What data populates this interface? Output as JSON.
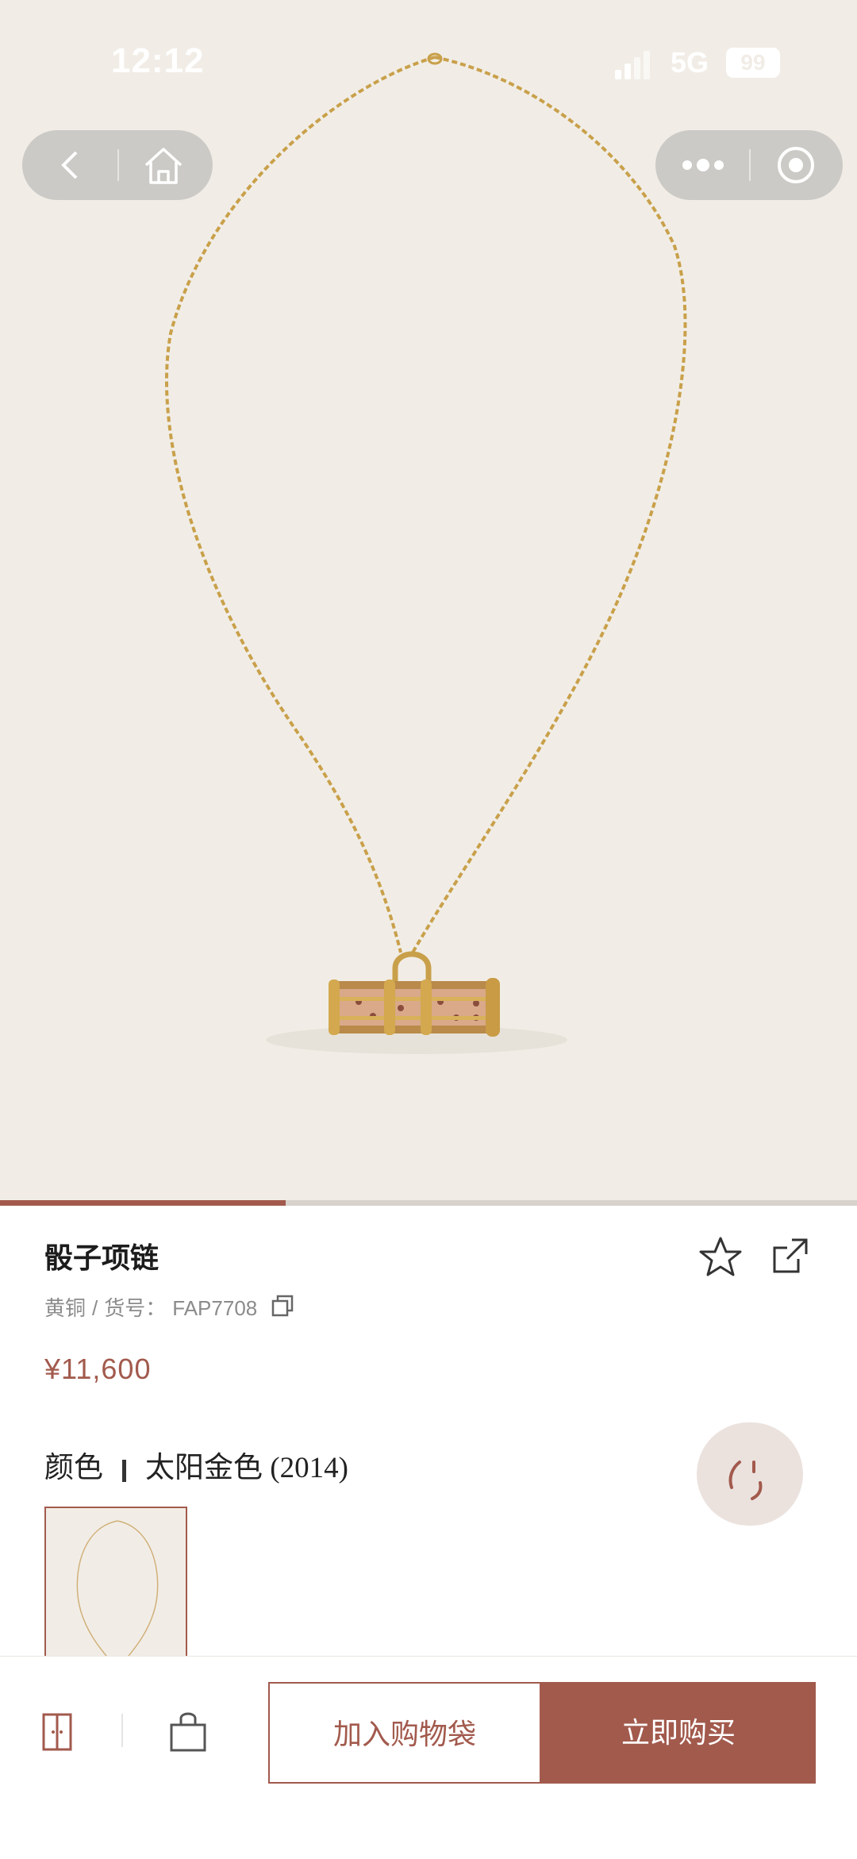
{
  "status_bar": {
    "time": "12:12",
    "network": "5G",
    "battery": "99"
  },
  "product": {
    "name": "骰子项链",
    "material": "黄铜",
    "sku_label": "货号：",
    "sku": "FAP7708",
    "price": "¥11,600",
    "color_label": "颜色",
    "color_value": "太阳金色 (2014)"
  },
  "gallery": {
    "progress": 0.333
  },
  "actions": {
    "add_to_bag": "加入购物袋",
    "buy_now": "立即购买"
  },
  "colors": {
    "accent": "#a25a4d",
    "background": "#f1ede6",
    "gold": "#c9a04a"
  },
  "icons": [
    "back-icon",
    "home-icon",
    "more-icon",
    "close-miniprogram-icon",
    "star-icon",
    "share-icon",
    "copy-icon",
    "chat-icon",
    "wardrobe-icon",
    "bag-icon"
  ]
}
